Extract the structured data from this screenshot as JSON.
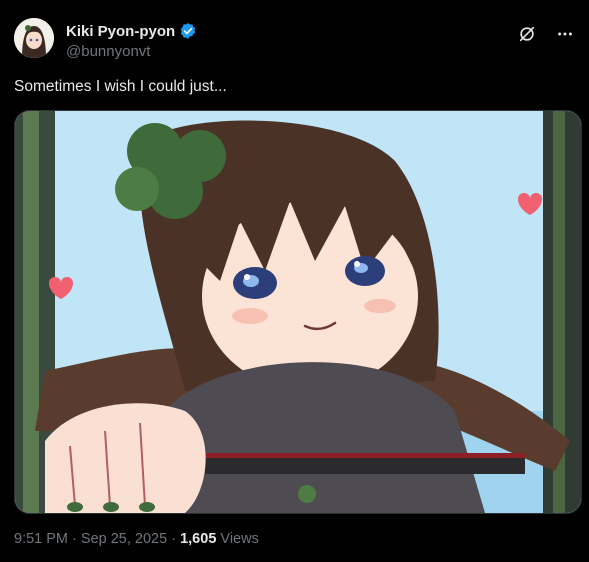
{
  "author": {
    "display_name": "Kiki Pyon-pyon",
    "handle": "@bunnyonvt",
    "verified": true,
    "avatar_icon": "avatar-image"
  },
  "header_icons": [
    "grok-icon",
    "more-icon"
  ],
  "tweet": {
    "text": "Sometimes I wish I could just...",
    "media_icon": "illustration-image"
  },
  "meta": {
    "time": "9:51 PM",
    "separator": "·",
    "date": "Sep 25, 2025",
    "views_count": "1,605",
    "views_label": "Views"
  },
  "colors": {
    "background": "#000000",
    "text": "#e7e9ea",
    "secondary": "#71767b",
    "verified": "#1d9bf0"
  }
}
